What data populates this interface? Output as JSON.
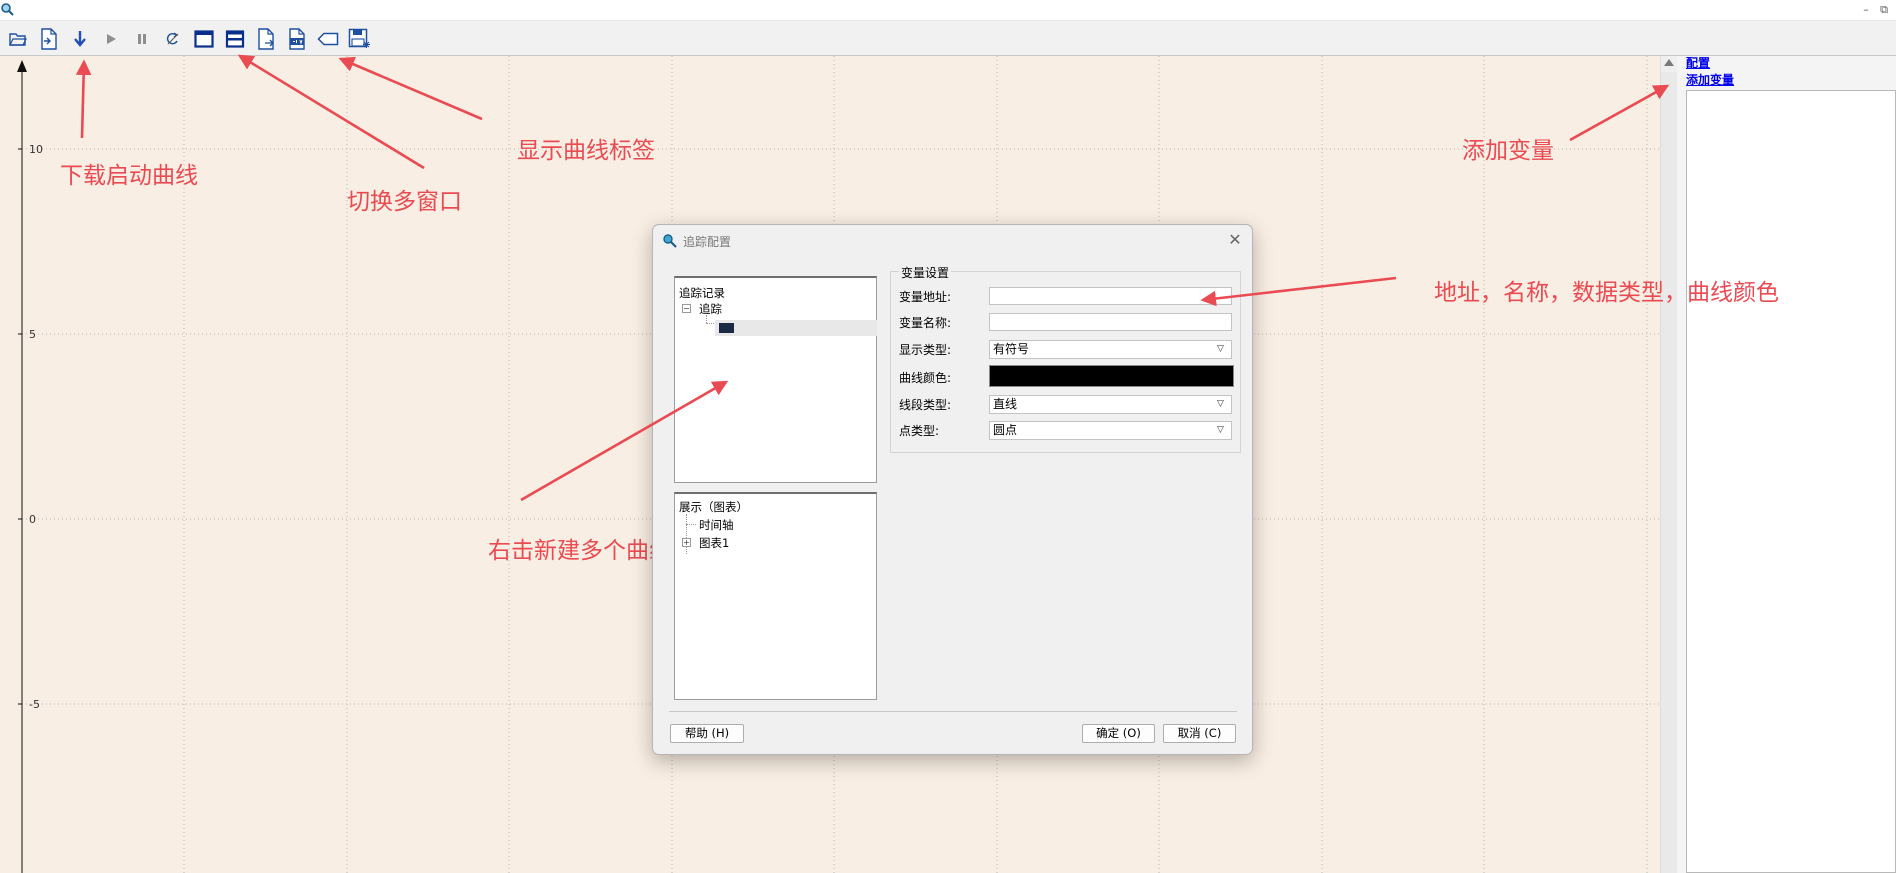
{
  "window": {
    "minimize_label": "–",
    "maximize_label": "⧉"
  },
  "toolbar": {
    "buttons": [
      {
        "icon": "open-folder-icon"
      },
      {
        "icon": "new-file-icon"
      },
      {
        "icon": "download-icon"
      },
      {
        "icon": "play-icon"
      },
      {
        "icon": "pause-icon"
      },
      {
        "icon": "reset-icon"
      },
      {
        "icon": "single-window-icon"
      },
      {
        "icon": "multi-window-icon"
      },
      {
        "icon": "export-icon"
      },
      {
        "icon": "csv-icon"
      },
      {
        "icon": "label-tag-icon"
      },
      {
        "icon": "save-settings-icon"
      }
    ]
  },
  "plot": {
    "background": "#f9eee3",
    "y_ticks": [
      "10",
      "5",
      "0",
      "-5"
    ]
  },
  "right_panel": {
    "config_link": "配置",
    "add_variable_link": "添加变量"
  },
  "annotations": {
    "download_start": "下载启动曲线",
    "switch_multiwindow": "切换多窗口",
    "show_labels": "显示曲线标签",
    "add_variable": "添加变量",
    "address_hint": "地址，名称，数据类型，曲线颜色",
    "right_click_hint": "右击新建多个曲线",
    "color": "#ea4a52"
  },
  "dialog": {
    "title": "追踪配置",
    "tree_trace": {
      "root": "追踪记录",
      "child": "追踪",
      "swatch_color": "#1a2a44"
    },
    "tree_display": {
      "root": "展示（图表）",
      "child1": "时间轴",
      "child2": "图表1"
    },
    "group_title": "变量设置",
    "fields": {
      "address_label": "变量地址:",
      "address_value": "",
      "name_label": "变量名称:",
      "name_value": "",
      "display_type_label": "显示类型:",
      "display_type_value": "有符号",
      "curve_color_label": "曲线颜色:",
      "curve_color_value": "#000000",
      "segment_type_label": "线段类型:",
      "segment_type_value": "直线",
      "point_type_label": "点类型:",
      "point_type_value": "圆点"
    },
    "buttons": {
      "help": "帮助 (H)",
      "ok": "确定 (O)",
      "cancel": "取消 (C)"
    }
  }
}
